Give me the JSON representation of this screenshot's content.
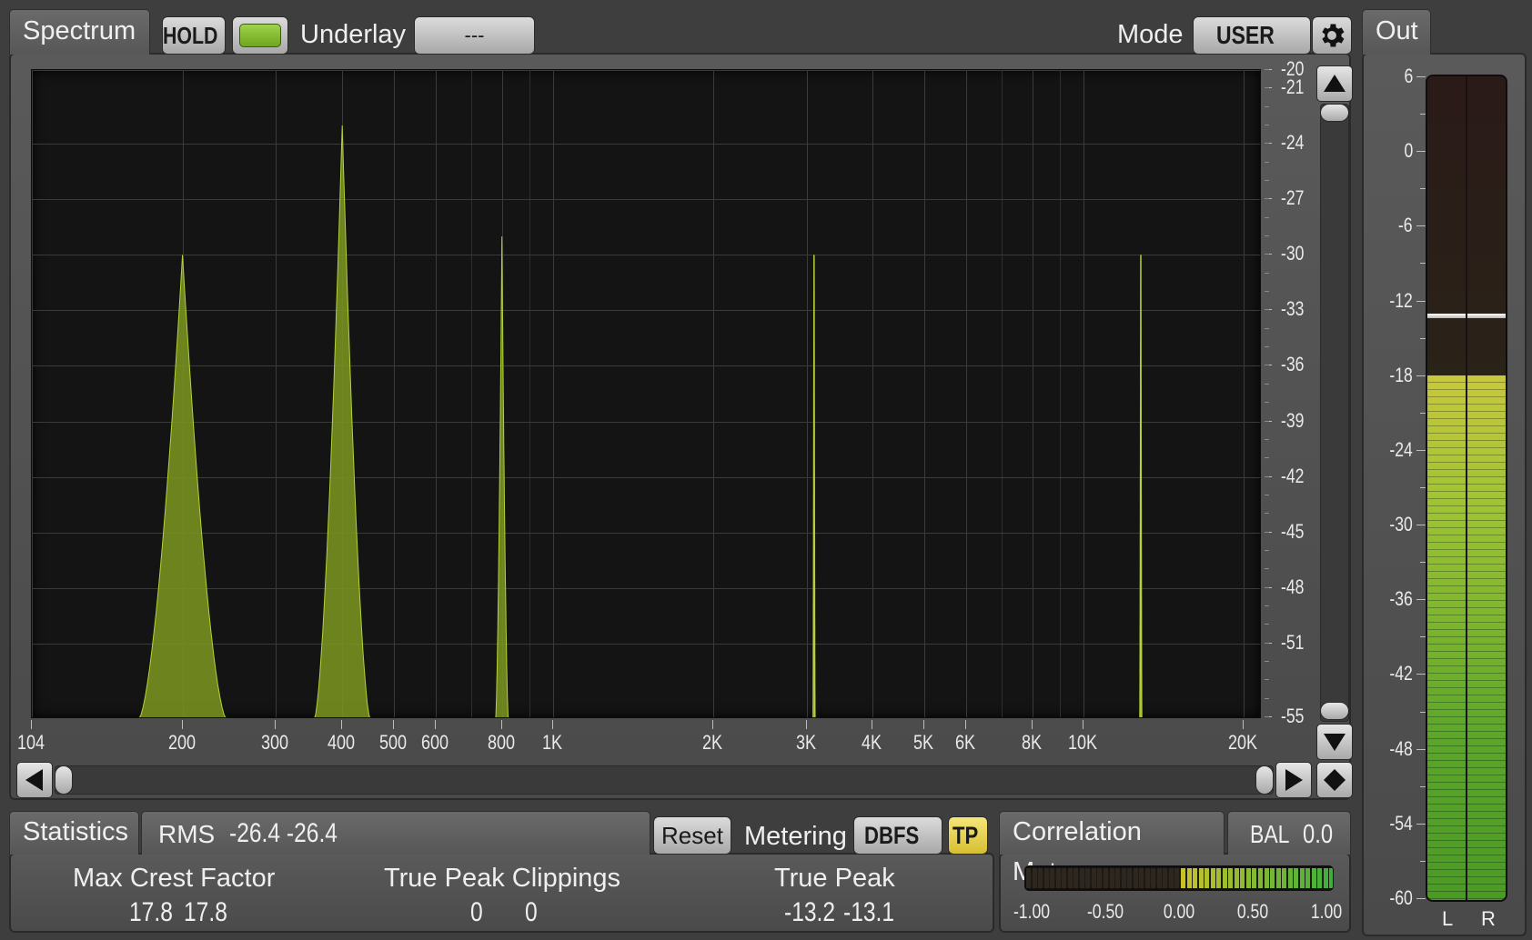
{
  "spectrum": {
    "tab_label": "Spectrum",
    "hold_label": "HOLD",
    "underlay_label": "Underlay",
    "underlay_value": "---",
    "mode_label": "Mode",
    "mode_value": "USER",
    "y_axis": {
      "max": -20,
      "min": -55,
      "ticks": [
        "-20",
        "-21",
        "-24",
        "-27",
        "-30",
        "-33",
        "-36",
        "-39",
        "-42",
        "-45",
        "-48",
        "-51",
        "-55"
      ],
      "tick_values": [
        -20,
        -21,
        -24,
        -27,
        -30,
        -33,
        -36,
        -39,
        -42,
        -45,
        -48,
        -51,
        -55
      ]
    },
    "x_axis": {
      "min_hz": 104,
      "max_hz": 20000,
      "scale": "log",
      "labels": [
        {
          "text": "104",
          "hz": 104
        },
        {
          "text": "200",
          "hz": 200
        },
        {
          "text": "300",
          "hz": 300
        },
        {
          "text": "400",
          "hz": 400
        },
        {
          "text": "500",
          "hz": 500
        },
        {
          "text": "600",
          "hz": 600
        },
        {
          "text": "800",
          "hz": 800
        },
        {
          "text": "1K",
          "hz": 1000
        },
        {
          "text": "2K",
          "hz": 2000
        },
        {
          "text": "3K",
          "hz": 3000
        },
        {
          "text": "4K",
          "hz": 4000
        },
        {
          "text": "5K",
          "hz": 5000
        },
        {
          "text": "6K",
          "hz": 6000
        },
        {
          "text": "8K",
          "hz": 8000
        },
        {
          "text": "10K",
          "hz": 10000
        },
        {
          "text": "20K",
          "hz": 20000
        }
      ]
    },
    "peaks": [
      {
        "hz": 200,
        "db": -30.0,
        "width_oct": 0.55
      },
      {
        "hz": 400,
        "db": -23.0,
        "width_oct": 0.35
      },
      {
        "hz": 800,
        "db": -29.0,
        "width_oct": 0.08
      },
      {
        "hz": 3100,
        "db": -30.0,
        "width_oct": 0.01
      },
      {
        "hz": 12800,
        "db": -30.0,
        "width_oct": 0.005
      }
    ],
    "fill_color": "#7d9620",
    "line_color": "#b4d23a"
  },
  "statistics": {
    "tab_label": "Statistics",
    "rms_label": "RMS",
    "rms_values": "-26.4 -26.4",
    "reset_label": "Reset",
    "metering_label": "Metering",
    "dbfs_label": "DBFS",
    "tp_label": "TP",
    "max_crest_label": "Max Crest Factor",
    "max_crest_l": "17.8",
    "max_crest_r": "17.8",
    "tp_clip_label": "True Peak Clippings",
    "tp_clip_l": "0",
    "tp_clip_r": "0",
    "true_peak_label": "True Peak",
    "true_peak_l": "-13.2",
    "true_peak_r": "-13.1"
  },
  "correlation": {
    "tab_label": "Correlation Meter",
    "bal_label": "BAL",
    "bal_value": "0.0",
    "scale": [
      "-1.00",
      "-0.50",
      "0.00",
      "0.50",
      "1.00"
    ],
    "range_low": 0.0,
    "range_high": 1.0
  },
  "out": {
    "tab_label": "Out",
    "scale": [
      "6",
      "0",
      "-6",
      "-12",
      "-18",
      "-24",
      "-30",
      "-36",
      "-42",
      "-48",
      "-54",
      "-60"
    ],
    "scale_values": [
      6,
      0,
      -6,
      -12,
      -18,
      -24,
      -30,
      -36,
      -42,
      -48,
      -54,
      -60
    ],
    "level_db": -18.0,
    "peak_hold_db": -13.2,
    "left_label": "L",
    "right_label": "R"
  }
}
